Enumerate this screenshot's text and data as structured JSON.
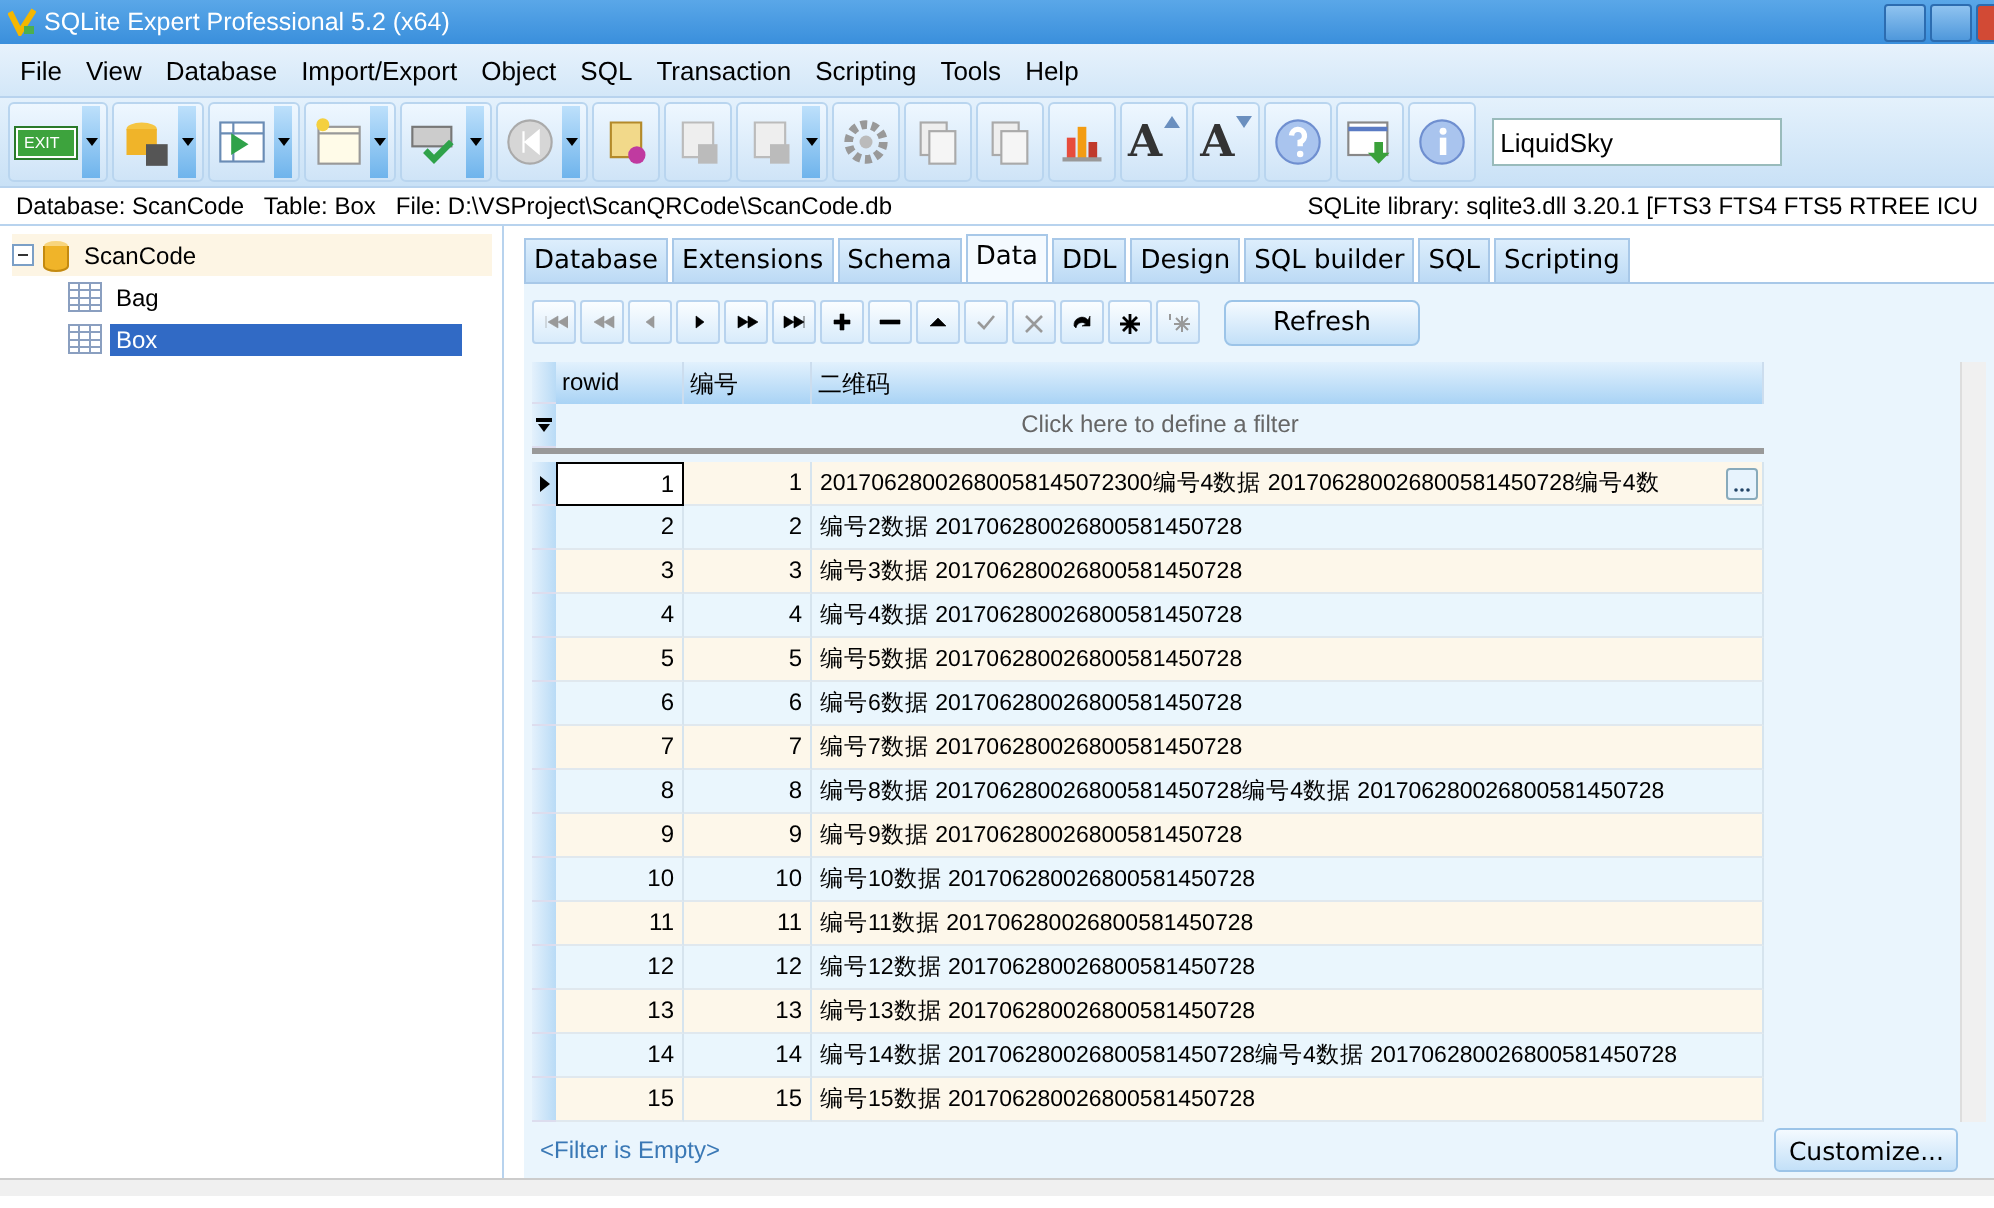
{
  "window": {
    "title": "SQLite Expert Professional 5.2 (x64)"
  },
  "menu": [
    "File",
    "View",
    "Database",
    "Import/Export",
    "Object",
    "SQL",
    "Transaction",
    "Scripting",
    "Tools",
    "Help"
  ],
  "toolbar": {
    "buttons": [
      {
        "kind": "exit",
        "label": "EXIT",
        "dropdown": true
      },
      {
        "kind": "dbsave",
        "dropdown": true
      },
      {
        "kind": "tableimport",
        "dropdown": true
      },
      {
        "kind": "newwin",
        "dropdown": true
      },
      {
        "kind": "check",
        "dropdown": true
      },
      {
        "kind": "back",
        "dropdown": true
      },
      {
        "kind": "script"
      },
      {
        "kind": "scriptsave"
      },
      {
        "kind": "scriptsave",
        "dropdown": true
      },
      {
        "kind": "gear"
      },
      {
        "kind": "copy"
      },
      {
        "kind": "copy"
      },
      {
        "kind": "chart"
      },
      {
        "kind": "fontup",
        "label": "A"
      },
      {
        "kind": "fontdown",
        "label": "A"
      },
      {
        "kind": "help"
      },
      {
        "kind": "download"
      },
      {
        "kind": "info"
      }
    ],
    "theme": "LiquidSky"
  },
  "info_bar": {
    "left": "Database: ScanCode   Table: Box   File: D:\\VSProject\\ScanQRCode\\ScanCode.db",
    "right": "SQLite library: sqlite3.dll 3.20.1 [FTS3 FTS4 FTS5 RTREE ICU"
  },
  "tree": [
    {
      "label": "ScanCode",
      "kind": "database",
      "expanded": true,
      "selected": false,
      "children": [
        {
          "label": "Bag",
          "kind": "table",
          "selected": false
        },
        {
          "label": "Box",
          "kind": "table",
          "selected": true
        }
      ]
    }
  ],
  "tabs": [
    {
      "label": "Database",
      "selected": false
    },
    {
      "label": "Extensions",
      "selected": false
    },
    {
      "label": "Schema",
      "selected": false
    },
    {
      "label": "Data",
      "selected": true
    },
    {
      "label": "DDL",
      "selected": false
    },
    {
      "label": "Design",
      "selected": false
    },
    {
      "label": "SQL builder",
      "selected": false
    },
    {
      "label": "SQL",
      "selected": false
    },
    {
      "label": "Scripting",
      "selected": false
    }
  ],
  "navigator": {
    "buttons": [
      {
        "kind": "first",
        "disabled": true
      },
      {
        "kind": "prevpage",
        "disabled": true
      },
      {
        "kind": "prev",
        "disabled": true
      },
      {
        "kind": "next",
        "disabled": false
      },
      {
        "kind": "nextpage",
        "disabled": false
      },
      {
        "kind": "last",
        "disabled": false
      },
      {
        "kind": "insert",
        "disabled": false
      },
      {
        "kind": "delete",
        "disabled": false
      },
      {
        "kind": "edit",
        "disabled": false
      },
      {
        "kind": "post",
        "disabled": true
      },
      {
        "kind": "cancel",
        "disabled": true
      },
      {
        "kind": "refresh",
        "disabled": false
      },
      {
        "kind": "bookmark",
        "disabled": false
      },
      {
        "kind": "gotobookmark",
        "disabled": true
      }
    ],
    "refresh": "Refresh"
  },
  "table": {
    "columns": [
      "rowid",
      "编号",
      "二维码"
    ],
    "filter_hint": "Click here to define a filter",
    "rows": [
      {
        "cells": [
          "1",
          "1",
          "20170628002680058145072300编号4数据 201706280026800581450728编号4数"
        ],
        "selected": true
      },
      {
        "cells": [
          "2",
          "2",
          "编号2数据 201706280026800581450728"
        ],
        "selected": false
      },
      {
        "cells": [
          "3",
          "3",
          "编号3数据 201706280026800581450728"
        ],
        "selected": false
      },
      {
        "cells": [
          "4",
          "4",
          "编号4数据 201706280026800581450728"
        ],
        "selected": false
      },
      {
        "cells": [
          "5",
          "5",
          "编号5数据 201706280026800581450728"
        ],
        "selected": false
      },
      {
        "cells": [
          "6",
          "6",
          "编号6数据 201706280026800581450728"
        ],
        "selected": false
      },
      {
        "cells": [
          "7",
          "7",
          "编号7数据 201706280026800581450728"
        ],
        "selected": false
      },
      {
        "cells": [
          "8",
          "8",
          "编号8数据 201706280026800581450728编号4数据 201706280026800581450728"
        ],
        "selected": false
      },
      {
        "cells": [
          "9",
          "9",
          "编号9数据 201706280026800581450728"
        ],
        "selected": false
      },
      {
        "cells": [
          "10",
          "10",
          "编号10数据 201706280026800581450728"
        ],
        "selected": false
      },
      {
        "cells": [
          "11",
          "11",
          "编号11数据 201706280026800581450728"
        ],
        "selected": false
      },
      {
        "cells": [
          "12",
          "12",
          "编号12数据 201706280026800581450728"
        ],
        "selected": false
      },
      {
        "cells": [
          "13",
          "13",
          "编号13数据 201706280026800581450728"
        ],
        "selected": false
      },
      {
        "cells": [
          "14",
          "14",
          "编号14数据 201706280026800581450728编号4数据 201706280026800581450728"
        ],
        "selected": false
      },
      {
        "cells": [
          "15",
          "15",
          "编号15数据 201706280026800581450728"
        ],
        "selected": false
      }
    ],
    "filter_status": "<Filter is Empty>",
    "customize": "Customize..."
  }
}
